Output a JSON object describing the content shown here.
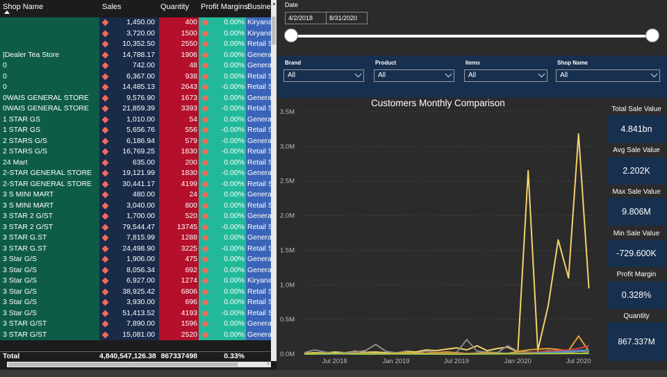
{
  "table": {
    "headers": {
      "shop_name": "Shop Name",
      "sales": "Sales",
      "quantity": "Quantity",
      "profit_margins": "Profit Margins",
      "business": "Busine"
    },
    "rows": [
      {
        "name": "",
        "sales": "1,450.00",
        "qty": "400",
        "pm": "0.00%",
        "biz": "Kiryana"
      },
      {
        "name": "",
        "sales": "3,720.00",
        "qty": "1500",
        "pm": "0.00%",
        "biz": "Kiryana"
      },
      {
        "name": "",
        "sales": "10,352.50",
        "qty": "2550",
        "pm": "0.00%",
        "biz": "Retail S"
      },
      {
        "name": "|Dealer Tea Store",
        "sales": "14,788.17",
        "qty": "1906",
        "pm": "0.00%",
        "biz": "Genera"
      },
      {
        "name": "0",
        "sales": "742.00",
        "qty": "48",
        "pm": "0.00%",
        "biz": "Genera"
      },
      {
        "name": "0",
        "sales": "6,367.00",
        "qty": "938",
        "pm": "0.00%",
        "biz": "Retail S"
      },
      {
        "name": "0",
        "sales": "14,485.13",
        "qty": "2643",
        "pm": "-0.00%",
        "biz": "Retail S"
      },
      {
        "name": "0WAIS GENERAL STORE",
        "sales": "9,576.90",
        "qty": "1673",
        "pm": "0.00%",
        "biz": "Genera"
      },
      {
        "name": "0WAIS GENERAL STORE",
        "sales": "21,859.39",
        "qty": "3393",
        "pm": "-0.00%",
        "biz": "Retail S"
      },
      {
        "name": "1 STAR GS",
        "sales": "1,010.00",
        "qty": "54",
        "pm": "0.00%",
        "biz": "Genera"
      },
      {
        "name": "1 STAR GS",
        "sales": "5,656.76",
        "qty": "556",
        "pm": "-0.00%",
        "biz": "Retail S"
      },
      {
        "name": "2 STARS G/S",
        "sales": "6,186.94",
        "qty": "579",
        "pm": "-0.00%",
        "biz": "Genera"
      },
      {
        "name": "2 STARS G/S",
        "sales": "16,769.25",
        "qty": "1830",
        "pm": "-0.00%",
        "biz": "Retail S"
      },
      {
        "name": "24 Mart",
        "sales": "635.00",
        "qty": "200",
        "pm": "0.00%",
        "biz": "Retail S"
      },
      {
        "name": "2-STAR GENERAL STORE",
        "sales": "19,121.99",
        "qty": "1830",
        "pm": "-0.00%",
        "biz": "Genera"
      },
      {
        "name": "2-STAR GENERAL STORE",
        "sales": "30,441.17",
        "qty": "4199",
        "pm": "-0.00%",
        "biz": "Retail S"
      },
      {
        "name": "3 S MINI MART",
        "sales": "480.00",
        "qty": "24",
        "pm": "0.00%",
        "biz": "Genera"
      },
      {
        "name": "3 S MINI MART",
        "sales": "3,040.00",
        "qty": "800",
        "pm": "0.00%",
        "biz": "Retail S"
      },
      {
        "name": "3 STAR 2 G/ST",
        "sales": "1,700.00",
        "qty": "520",
        "pm": "0.00%",
        "biz": "Genera"
      },
      {
        "name": "3 STAR 2 G/ST",
        "sales": "79,544.47",
        "qty": "13745",
        "pm": "-0.00%",
        "biz": "Retail S"
      },
      {
        "name": "3 STAR G.ST",
        "sales": "7,815.99",
        "qty": "1288",
        "pm": "0.00%",
        "biz": "Genera"
      },
      {
        "name": "3 STAR G.ST",
        "sales": "24,498.90",
        "qty": "3225",
        "pm": "-0.00%",
        "biz": "Retail S"
      },
      {
        "name": "3 Star G/S",
        "sales": "1,906.00",
        "qty": "475",
        "pm": "0.00%",
        "biz": "Genera"
      },
      {
        "name": "3 Star G/S",
        "sales": "8,056.34",
        "qty": "692",
        "pm": "0.00%",
        "biz": "Genera"
      },
      {
        "name": "3 Star G/S",
        "sales": "6,927.00",
        "qty": "1274",
        "pm": "0.00%",
        "biz": "Kiryana"
      },
      {
        "name": "3 Star G/S",
        "sales": "38,925.42",
        "qty": "6806",
        "pm": "0.00%",
        "biz": "Retail S"
      },
      {
        "name": "3 Star G/S",
        "sales": "3,930.00",
        "qty": "696",
        "pm": "0.00%",
        "biz": "Retail S"
      },
      {
        "name": "3 Star G/S",
        "sales": "51,413.52",
        "qty": "4193",
        "pm": "-0.00%",
        "biz": "Retail S"
      },
      {
        "name": "3 STAR G/ST",
        "sales": "7,890.00",
        "qty": "1596",
        "pm": "0.00%",
        "biz": "Genera"
      },
      {
        "name": "3 STAR G/ST",
        "sales": "15,081.00",
        "qty": "2520",
        "pm": "0.00%",
        "biz": "Genera"
      }
    ],
    "total": {
      "label": "Total",
      "sales": "4,840,547,126.38",
      "qty": "867337498",
      "pm": "0.33%"
    }
  },
  "date_slicer": {
    "title": "Date",
    "start": "4/2/2018",
    "end": "8/31/2020"
  },
  "filters": [
    {
      "label": "Brand",
      "value": "All"
    },
    {
      "label": "Product",
      "value": "All"
    },
    {
      "label": "Items",
      "value": "All"
    },
    {
      "label": "Shop Name",
      "value": "All"
    }
  ],
  "kpis": [
    {
      "label": "Total Sale Value",
      "value": "4.841bn"
    },
    {
      "label": "Avg Sale Value",
      "value": "2.202K"
    },
    {
      "label": "Max Sale Value",
      "value": "9.806M"
    },
    {
      "label": "Min Sale Value",
      "value": "-729.600K"
    },
    {
      "label": "Profit Margin",
      "value": "0.328%"
    },
    {
      "label": "Quantity",
      "value": "867.337M"
    }
  ],
  "colors": {
    "shop_col": "#0e5c48",
    "sales_col": "#1a2b48",
    "qty_col": "#b4102b",
    "pm_col": "#21b99a",
    "biz_col": "#3a64b8",
    "diamond": "#f36b5a",
    "panel": "#18304f",
    "main_line": "#f7d26b"
  },
  "icons": {
    "sort": "sort-ascending-icon",
    "marker": "diamond-marker-icon",
    "chevron": "chevron-down-icon"
  },
  "chart_data": {
    "type": "line",
    "title": "Customers Monthly Comparison",
    "ylim": [
      0,
      3500000
    ],
    "y_ticks": [
      "0.0M",
      "0.5M",
      "1.0M",
      "1.5M",
      "2.0M",
      "2.5M",
      "3.0M",
      "3.5M"
    ],
    "x_ticks": [
      "Jul 2018",
      "Jan 2019",
      "Jul 2019",
      "Jan 2020",
      "Jul 2020"
    ],
    "x_range": [
      "2018-04-01",
      "2020-08-31"
    ],
    "grid": true,
    "legend": "none",
    "series": [
      {
        "color": "#f7d26b",
        "points": [
          [
            "2018-04-01",
            10000
          ],
          [
            "2018-05-01",
            20000
          ],
          [
            "2018-06-01",
            15000
          ],
          [
            "2018-07-01",
            30000
          ],
          [
            "2018-08-01",
            20000
          ],
          [
            "2018-09-01",
            40000
          ],
          [
            "2018-10-01",
            25000
          ],
          [
            "2018-11-01",
            30000
          ],
          [
            "2018-12-01",
            20000
          ],
          [
            "2019-01-01",
            15000
          ],
          [
            "2019-02-01",
            40000
          ],
          [
            "2019-03-01",
            30000
          ],
          [
            "2019-04-01",
            60000
          ],
          [
            "2019-05-01",
            50000
          ],
          [
            "2019-06-01",
            70000
          ],
          [
            "2019-07-01",
            90000
          ],
          [
            "2019-08-01",
            60000
          ],
          [
            "2019-09-01",
            120000
          ],
          [
            "2019-10-01",
            50000
          ],
          [
            "2019-11-01",
            80000
          ],
          [
            "2019-12-01",
            100000
          ],
          [
            "2020-01-01",
            30000
          ],
          [
            "2020-02-01",
            2650000
          ],
          [
            "2020-03-01",
            50000
          ],
          [
            "2020-04-01",
            700000
          ],
          [
            "2020-05-01",
            1650000
          ],
          [
            "2020-06-01",
            1100000
          ],
          [
            "2020-07-01",
            3180000
          ],
          [
            "2020-08-01",
            950000
          ]
        ]
      },
      {
        "color": "#8a8a8a",
        "points": [
          [
            "2018-04-01",
            20000
          ],
          [
            "2018-05-01",
            60000
          ],
          [
            "2018-06-01",
            30000
          ],
          [
            "2018-07-01",
            10000
          ],
          [
            "2018-08-01",
            20000
          ],
          [
            "2018-09-01",
            30000
          ],
          [
            "2018-10-01",
            50000
          ],
          [
            "2018-11-01",
            140000
          ],
          [
            "2018-12-01",
            40000
          ],
          [
            "2019-01-01",
            20000
          ],
          [
            "2019-02-01",
            30000
          ],
          [
            "2019-03-01",
            10000
          ],
          [
            "2019-04-01",
            40000
          ],
          [
            "2019-05-01",
            20000
          ],
          [
            "2019-06-01",
            30000
          ],
          [
            "2019-07-01",
            20000
          ],
          [
            "2019-08-01",
            210000
          ],
          [
            "2019-09-01",
            40000
          ],
          [
            "2019-10-01",
            30000
          ],
          [
            "2019-11-01",
            20000
          ],
          [
            "2019-12-01",
            120000
          ],
          [
            "2020-01-01",
            40000
          ],
          [
            "2020-02-01",
            30000
          ],
          [
            "2020-03-01",
            20000
          ],
          [
            "2020-04-01",
            50000
          ],
          [
            "2020-05-01",
            30000
          ],
          [
            "2020-06-01",
            20000
          ],
          [
            "2020-07-01",
            40000
          ],
          [
            "2020-08-01",
            30000
          ]
        ]
      },
      {
        "color": "#e8a030",
        "points": [
          [
            "2018-04-01",
            5000
          ],
          [
            "2018-06-01",
            10000
          ],
          [
            "2018-08-01",
            5000
          ],
          [
            "2018-10-01",
            15000
          ],
          [
            "2018-12-01",
            5000
          ],
          [
            "2019-02-01",
            20000
          ],
          [
            "2019-04-01",
            10000
          ],
          [
            "2019-06-01",
            30000
          ],
          [
            "2019-08-01",
            10000
          ],
          [
            "2019-10-01",
            20000
          ],
          [
            "2019-12-01",
            10000
          ],
          [
            "2020-02-01",
            60000
          ],
          [
            "2020-04-01",
            80000
          ],
          [
            "2020-06-01",
            50000
          ],
          [
            "2020-07-01",
            260000
          ],
          [
            "2020-08-01",
            40000
          ]
        ]
      },
      {
        "color": "#d64545",
        "points": [
          [
            "2018-04-01",
            0
          ],
          [
            "2018-08-01",
            5000
          ],
          [
            "2018-12-01",
            0
          ],
          [
            "2019-04-01",
            5000
          ],
          [
            "2019-08-01",
            10000
          ],
          [
            "2019-12-01",
            5000
          ],
          [
            "2020-02-01",
            20000
          ],
          [
            "2020-04-01",
            40000
          ],
          [
            "2020-06-01",
            60000
          ],
          [
            "2020-07-01",
            80000
          ],
          [
            "2020-08-01",
            120000
          ]
        ]
      },
      {
        "color": "#4a90d9",
        "points": [
          [
            "2018-04-01",
            0
          ],
          [
            "2018-10-01",
            5000
          ],
          [
            "2019-04-01",
            0
          ],
          [
            "2019-10-01",
            5000
          ],
          [
            "2020-02-01",
            10000
          ],
          [
            "2020-05-01",
            30000
          ],
          [
            "2020-08-01",
            60000
          ]
        ]
      },
      {
        "color": "#a8d040",
        "points": [
          [
            "2018-04-01",
            0
          ],
          [
            "2018-07-01",
            8000
          ],
          [
            "2018-10-01",
            0
          ],
          [
            "2019-01-01",
            5000
          ],
          [
            "2019-07-01",
            0
          ],
          [
            "2020-01-01",
            5000
          ],
          [
            "2020-08-01",
            10000
          ]
        ]
      }
    ]
  }
}
